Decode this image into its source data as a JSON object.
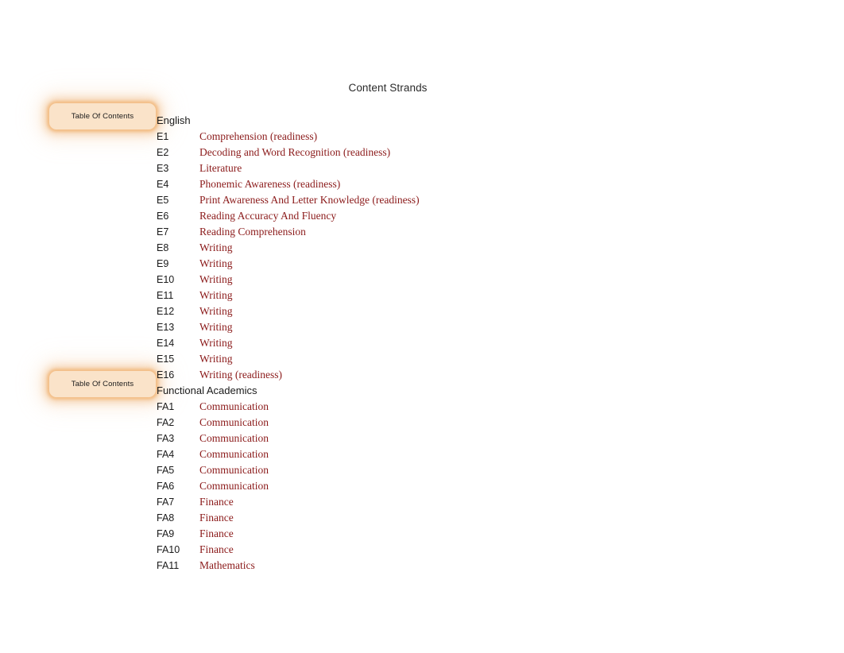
{
  "page": {
    "title": "Content Strands",
    "accent_red": "#8b1a1a",
    "toc_fill": "#fae3c9",
    "toc_glow": "#eea75c"
  },
  "toc_buttons": [
    {
      "label": "Table Of Contents"
    },
    {
      "label": "Table Of Contents"
    }
  ],
  "sections": [
    {
      "heading": "English",
      "rows": [
        {
          "code": "E1",
          "name": "Comprehension (readiness)"
        },
        {
          "code": "E2",
          "name": "Decoding and Word Recognition (readiness)"
        },
        {
          "code": "E3",
          "name": "Literature"
        },
        {
          "code": "E4",
          "name": "Phonemic Awareness (readiness)"
        },
        {
          "code": "E5",
          "name": "Print Awareness And Letter Knowledge (readiness)"
        },
        {
          "code": "E6",
          "name": "Reading Accuracy And Fluency"
        },
        {
          "code": "E7",
          "name": "Reading Comprehension"
        },
        {
          "code": "E8",
          "name": "Writing"
        },
        {
          "code": "E9",
          "name": "Writing"
        },
        {
          "code": "E10",
          "name": "Writing"
        },
        {
          "code": "E11",
          "name": "Writing"
        },
        {
          "code": "E12",
          "name": "Writing"
        },
        {
          "code": "E13",
          "name": "Writing"
        },
        {
          "code": "E14",
          "name": "Writing"
        },
        {
          "code": "E15",
          "name": "Writing"
        },
        {
          "code": "E16",
          "name": "Writing (readiness)"
        }
      ]
    },
    {
      "heading": "Functional Academics",
      "rows": [
        {
          "code": "FA1",
          "name": "Communication"
        },
        {
          "code": "FA2",
          "name": "Communication"
        },
        {
          "code": "FA3",
          "name": "Communication"
        },
        {
          "code": "FA4",
          "name": "Communication"
        },
        {
          "code": "FA5",
          "name": "Communication"
        },
        {
          "code": "FA6",
          "name": "Communication"
        },
        {
          "code": "FA7",
          "name": "Finance"
        },
        {
          "code": "FA8",
          "name": "Finance"
        },
        {
          "code": "FA9",
          "name": "Finance"
        },
        {
          "code": "FA10",
          "name": "Finance"
        },
        {
          "code": "FA11",
          "name": "Mathematics"
        }
      ]
    }
  ]
}
